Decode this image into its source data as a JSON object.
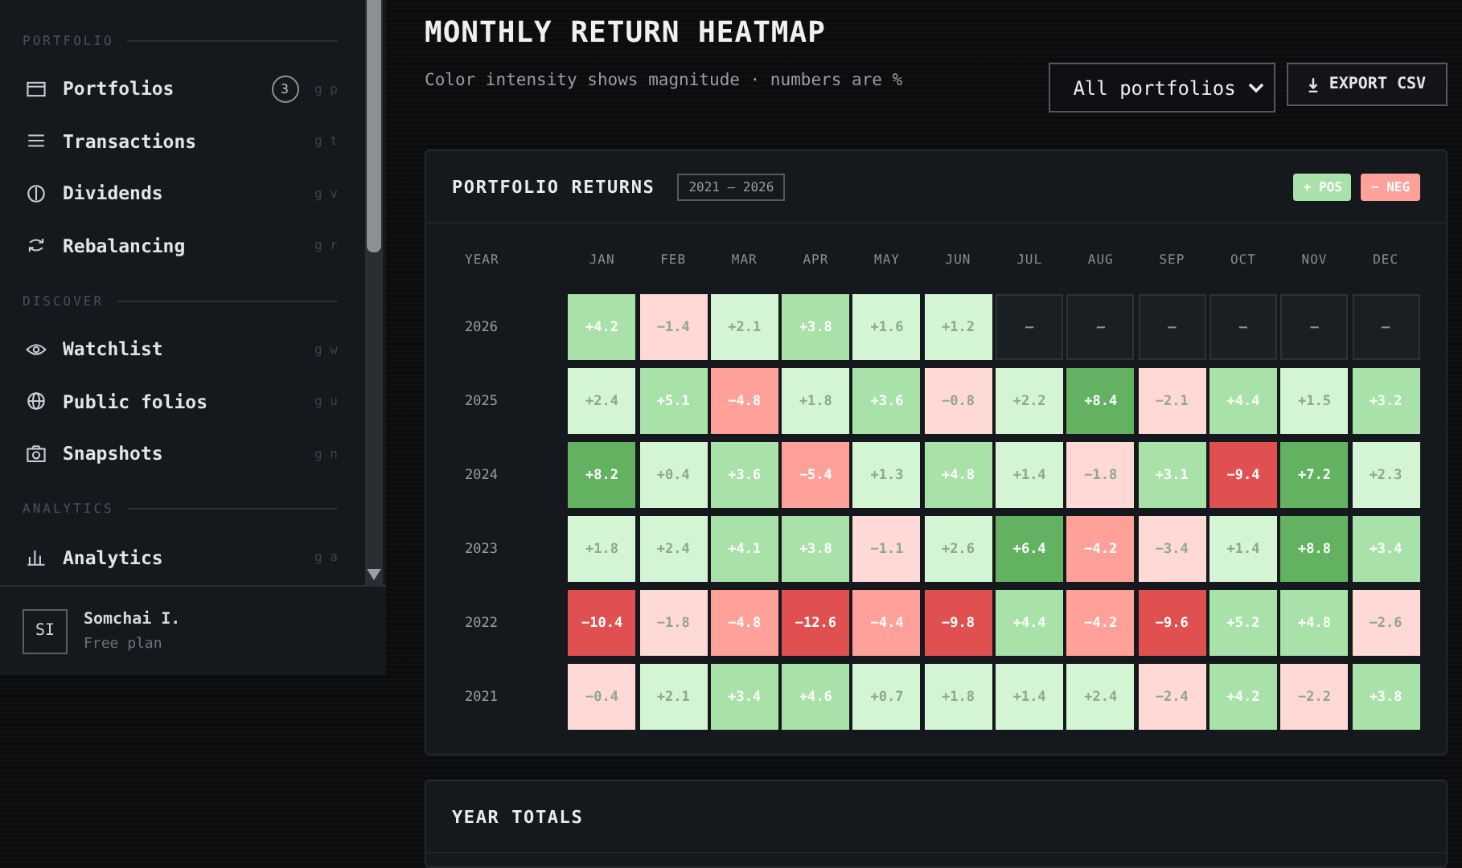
{
  "sidebar": {
    "sections": [
      {
        "title": "PORTFOLIO",
        "items": [
          {
            "label": "Portfolios",
            "badge": "3",
            "shortcut": "g p"
          },
          {
            "label": "Transactions",
            "shortcut": "g t"
          },
          {
            "label": "Dividends",
            "shortcut": "g v"
          },
          {
            "label": "Rebalancing",
            "shortcut": "g r"
          }
        ]
      },
      {
        "title": "DISCOVER",
        "items": [
          {
            "label": "Watchlist",
            "shortcut": "g w"
          },
          {
            "label": "Public folios",
            "shortcut": "g u"
          },
          {
            "label": "Snapshots",
            "shortcut": "g n"
          }
        ]
      },
      {
        "title": "ANALYTICS",
        "items": [
          {
            "label": "Analytics",
            "shortcut": "g a"
          }
        ]
      }
    ],
    "user": {
      "initials": "SI",
      "name": "Somchai I.",
      "plan": "Free plan"
    }
  },
  "header": {
    "title": "MONTHLY RETURN HEATMAP",
    "subtitle": "Color intensity shows magnitude · numbers are %",
    "select": {
      "value": "All portfolios"
    },
    "export_button": {
      "label": "EXPORT CSV"
    }
  },
  "heatmap": {
    "title": "PORTFOLIO RETURNS",
    "range": "2021 – 2026",
    "legend": [
      {
        "label": "+ POS",
        "color": "#a8e2a8"
      },
      {
        "label": "− NEG",
        "color": "#ffa198"
      }
    ],
    "year_column": "YEAR",
    "columns": [
      "JAN",
      "FEB",
      "MAR",
      "APR",
      "MAY",
      "JUN",
      "JUL",
      "AUG",
      "SEP",
      "OCT",
      "NOV",
      "DEC"
    ],
    "rows": [
      {
        "year": "2026",
        "cells": [
          {
            "value": "+4.2",
            "color": "#a8e2a8"
          },
          {
            "value": "−1.4",
            "color": "#ffd9d6"
          },
          {
            "value": "+2.1",
            "color": "#d4f5d4"
          },
          {
            "value": "+3.8",
            "color": "#a8e2a8"
          },
          {
            "value": "+1.6",
            "color": "#d4f5d4"
          },
          {
            "value": "+1.2",
            "color": "#d4f5d4"
          },
          {
            "value": "–",
            "kind": "empty"
          },
          {
            "value": "–",
            "kind": "empty"
          },
          {
            "value": "–",
            "kind": "empty"
          },
          {
            "value": "–",
            "kind": "empty"
          },
          {
            "value": "–",
            "kind": "empty"
          },
          {
            "value": "–",
            "kind": "empty"
          }
        ]
      },
      {
        "year": "2025",
        "cells": [
          {
            "value": "+2.4",
            "color": "#d4f5d4"
          },
          {
            "value": "+5.1",
            "color": "#a8e2a8"
          },
          {
            "value": "−4.8",
            "color": "#ffa198"
          },
          {
            "value": "+1.8",
            "color": "#d4f5d4"
          },
          {
            "value": "+3.6",
            "color": "#a8e2a8"
          },
          {
            "value": "−0.8",
            "color": "#ffd9d6"
          },
          {
            "value": "+2.2",
            "color": "#d4f5d4"
          },
          {
            "value": "+8.4",
            "color": "#62b262"
          },
          {
            "value": "−2.1",
            "color": "#ffd9d6"
          },
          {
            "value": "+4.4",
            "color": "#a8e2a8"
          },
          {
            "value": "+1.5",
            "color": "#d4f5d4"
          },
          {
            "value": "+3.2",
            "color": "#a8e2a8"
          }
        ]
      },
      {
        "year": "2024",
        "cells": [
          {
            "value": "+8.2",
            "color": "#62b262"
          },
          {
            "value": "+0.4",
            "color": "#d4f5d4"
          },
          {
            "value": "+3.6",
            "color": "#a8e2a8"
          },
          {
            "value": "−5.4",
            "color": "#ffa198"
          },
          {
            "value": "+1.3",
            "color": "#d4f5d4"
          },
          {
            "value": "+4.8",
            "color": "#a8e2a8"
          },
          {
            "value": "+1.4",
            "color": "#d4f5d4"
          },
          {
            "value": "−1.8",
            "color": "#ffd9d6"
          },
          {
            "value": "+3.1",
            "color": "#a8e2a8"
          },
          {
            "value": "−9.4",
            "color": "#e05050"
          },
          {
            "value": "+7.2",
            "color": "#62b262"
          },
          {
            "value": "+2.3",
            "color": "#d4f5d4"
          }
        ]
      },
      {
        "year": "2023",
        "cells": [
          {
            "value": "+1.8",
            "color": "#d4f5d4"
          },
          {
            "value": "+2.4",
            "color": "#d4f5d4"
          },
          {
            "value": "+4.1",
            "color": "#a8e2a8"
          },
          {
            "value": "+3.8",
            "color": "#a8e2a8"
          },
          {
            "value": "−1.1",
            "color": "#ffd9d6"
          },
          {
            "value": "+2.6",
            "color": "#d4f5d4"
          },
          {
            "value": "+6.4",
            "color": "#62b262"
          },
          {
            "value": "−4.2",
            "color": "#ffa198"
          },
          {
            "value": "−3.4",
            "color": "#ffd9d6"
          },
          {
            "value": "+1.4",
            "color": "#d4f5d4"
          },
          {
            "value": "+8.8",
            "color": "#62b262"
          },
          {
            "value": "+3.4",
            "color": "#a8e2a8"
          }
        ]
      },
      {
        "year": "2022",
        "cells": [
          {
            "value": "−10.4",
            "color": "#e05050"
          },
          {
            "value": "−1.8",
            "color": "#ffd9d6"
          },
          {
            "value": "−4.8",
            "color": "#ffa198"
          },
          {
            "value": "−12.6",
            "color": "#e05050"
          },
          {
            "value": "−4.4",
            "color": "#ffa198"
          },
          {
            "value": "−9.8",
            "color": "#e05050"
          },
          {
            "value": "+4.4",
            "color": "#a8e2a8"
          },
          {
            "value": "−4.2",
            "color": "#ffa198"
          },
          {
            "value": "−9.6",
            "color": "#e05050"
          },
          {
            "value": "+5.2",
            "color": "#a8e2a8"
          },
          {
            "value": "+4.8",
            "color": "#a8e2a8"
          },
          {
            "value": "−2.6",
            "color": "#ffd9d6"
          }
        ]
      },
      {
        "year": "2021",
        "cells": [
          {
            "value": "−0.4",
            "color": "#ffd9d6"
          },
          {
            "value": "+2.1",
            "color": "#d4f5d4"
          },
          {
            "value": "+3.4",
            "color": "#a8e2a8"
          },
          {
            "value": "+4.6",
            "color": "#a8e2a8"
          },
          {
            "value": "+0.7",
            "color": "#d4f5d4"
          },
          {
            "value": "+1.8",
            "color": "#d4f5d4"
          },
          {
            "value": "+1.4",
            "color": "#d4f5d4"
          },
          {
            "value": "+2.4",
            "color": "#d4f5d4"
          },
          {
            "value": "−2.4",
            "color": "#ffd9d6"
          },
          {
            "value": "+4.2",
            "color": "#a8e2a8"
          },
          {
            "value": "−2.2",
            "color": "#ffd9d6"
          },
          {
            "value": "+3.8",
            "color": "#a8e2a8"
          }
        ]
      }
    ]
  },
  "totals": {
    "title": "YEAR TOTALS"
  }
}
